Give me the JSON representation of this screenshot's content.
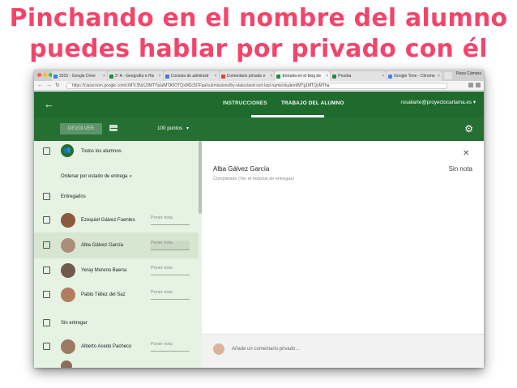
{
  "slide": {
    "headline_line1": "Pinchando en el nombre del alumno",
    "headline_line2": "puedes hablar por privado con él",
    "headline_color": "#f2456b"
  },
  "browser": {
    "tabs": [
      {
        "title": "2015 - Google Drive",
        "favicon_color": "#3b82d6"
      },
      {
        "title": "2º A - Geografía e His",
        "favicon_color": "#1e8e3e"
      },
      {
        "title": "Consola de administr",
        "favicon_color": "#4a76c6"
      },
      {
        "title": "Comentario privado e",
        "favicon_color": "#db4437"
      },
      {
        "title": "Entrada en el blog de",
        "favicon_color": "#1e8e3e"
      },
      {
        "title": "Prueba",
        "favicon_color": "#1e8e3e"
      },
      {
        "title": "Google Tone - Chrome",
        "favicon_color": "#4285f4"
      }
    ],
    "active_tab_index": 4,
    "profile_name": "Rosa Cámara",
    "url": "https://classroom.google.com/c/MTc3NzU3MTYa/a/MTA5OTQxMDc5OFpa/submissions/by-status/and-sort-last-name/student/MTg1MTQyMTha"
  },
  "header": {
    "back_icon": "arrow-back-icon",
    "tab_instructions": "INSTRUCCIONES",
    "tab_student_work": "TRABAJO DEL ALUMNO",
    "user_email": "rosaliarte@proyectocartama.es",
    "user_caret": "▾",
    "brand_color": "#1e6b2d"
  },
  "toolbar": {
    "return_label": "DEVOLVER",
    "points_label": "100 puntos",
    "points_caret": "▾"
  },
  "left_panel": {
    "all_students": "Todos los alumnos",
    "sort_label": "Ordenar por estado de entrega",
    "sort_caret": "▾",
    "group_turned_in": "Entregados",
    "group_not_turned_in": "Sin entregar",
    "grade_placeholder": "Poner nota",
    "students_turned_in": [
      {
        "name": "Ezequiel Gálvez Fuentes",
        "avatar_color": "#8b5a3c"
      },
      {
        "name": "Alba Gálvez García",
        "avatar_color": "#a98f7a"
      },
      {
        "name": "Yeray Moreno Baena",
        "avatar_color": "#6f5a4c"
      },
      {
        "name": "Pablo Téllez del Saz",
        "avatar_color": "#b07d5e"
      }
    ],
    "students_not_turned_in": [
      {
        "name": "Alberto Acedo Pacheco",
        "avatar_color": "#9a7a62"
      }
    ]
  },
  "right_panel": {
    "student_name": "Alba Gálvez García",
    "grade_status": "Sin nota",
    "status_line": "Completado (Ver el historial de entregas)",
    "comment_placeholder": "Añade un comentario privado…"
  }
}
